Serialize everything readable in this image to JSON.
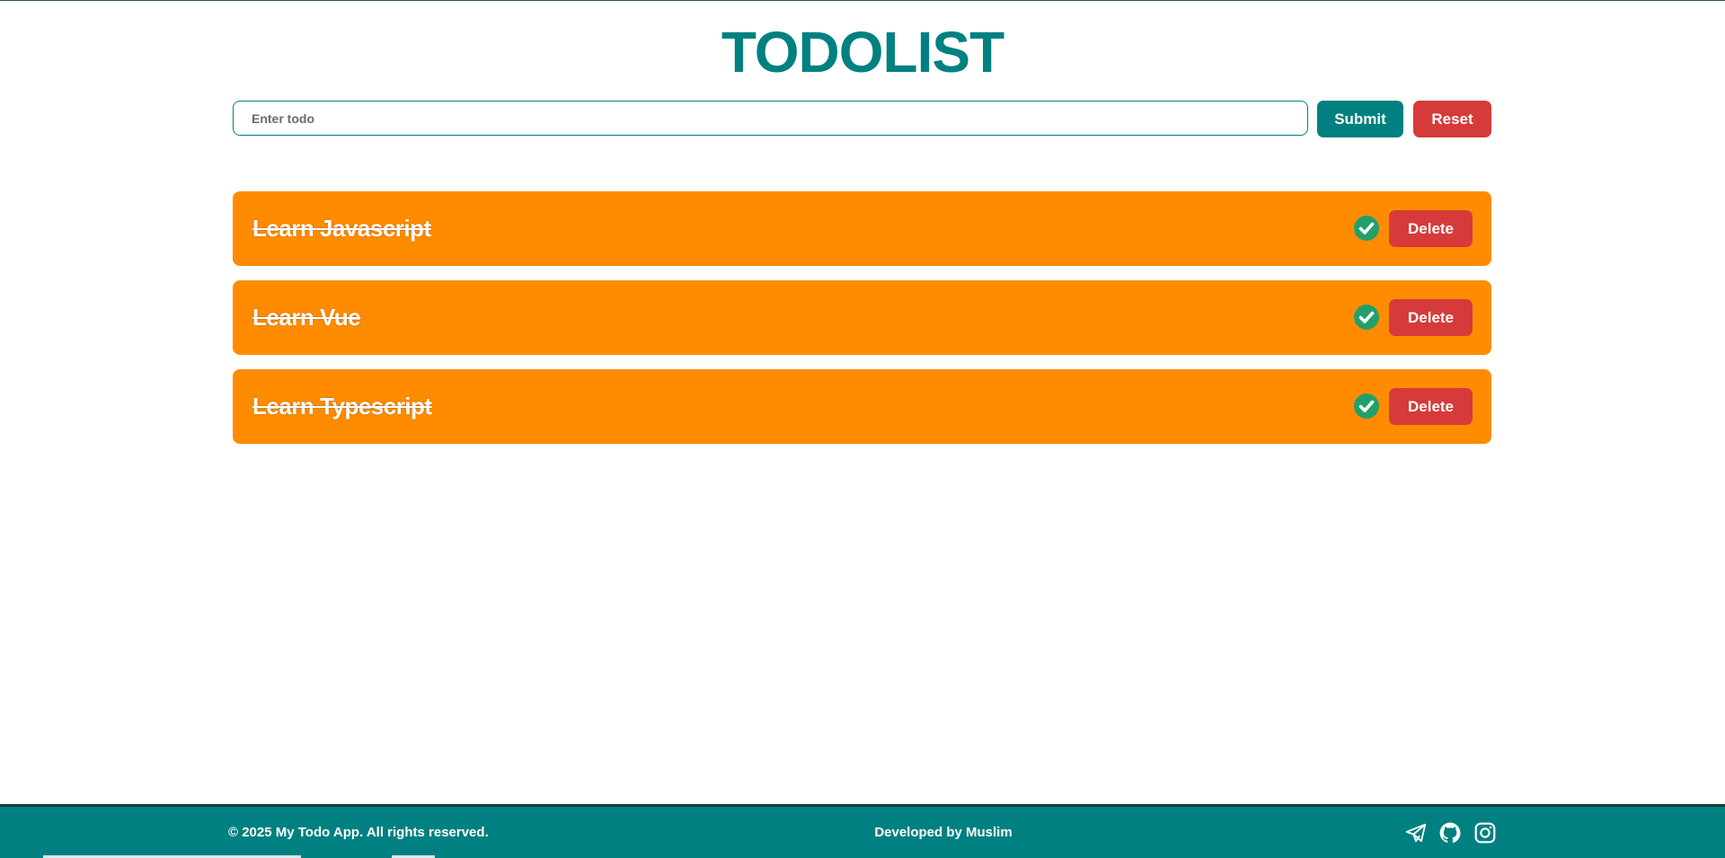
{
  "app": {
    "title": "TODOLIST"
  },
  "form": {
    "input_value": "",
    "input_placeholder": "Enter todo",
    "submit_label": "Submit",
    "reset_label": "Reset"
  },
  "todos": [
    {
      "text": "Learn Javascript",
      "completed": true,
      "delete_label": "Delete"
    },
    {
      "text": "Learn Vue",
      "completed": true,
      "delete_label": "Delete"
    },
    {
      "text": "Learn Typescript",
      "completed": true,
      "delete_label": "Delete"
    }
  ],
  "footer": {
    "copyright": "© 2025 My Todo App. All rights reserved.",
    "developer": "Developed by Muslim",
    "social_icons": [
      "telegram-icon",
      "github-icon",
      "instagram-icon"
    ]
  },
  "colors": {
    "primary": "#008080",
    "danger": "#d63a3a",
    "todo_bg": "#ff8c00",
    "check": "#22a06b"
  }
}
